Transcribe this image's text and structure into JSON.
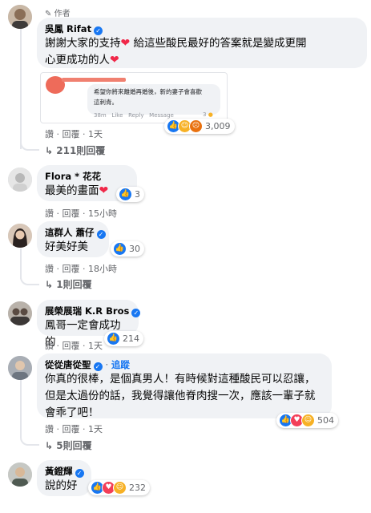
{
  "comments": [
    {
      "author": "吳鳳 Rifat",
      "author_badge": "作者",
      "text_line1": "謝謝大家的支持",
      "text_line1b": "給這些酸民最好的答案就是變成更開",
      "text_line2": "心更成功的人",
      "like": "讚",
      "reply": "回覆",
      "time": "1天",
      "reactions": "3,009",
      "replies": "211則回覆",
      "quote": {
        "text_line1": "希望你將來離婚再婚後，新的妻子會喜歡",
        "text_line2": "這刺青。",
        "time": "38m",
        "like": "Like",
        "reply": "Reply",
        "message": "Message",
        "count": "3"
      }
    },
    {
      "author": "Flora * 花花",
      "text": "最美的畫面",
      "like": "讚",
      "reply": "回覆",
      "time": "15小時",
      "reactions": "3"
    },
    {
      "author": "這群人 蕭仔",
      "text": "好美好美",
      "like": "讚",
      "reply": "回覆",
      "time": "18小時",
      "reactions": "30",
      "replies": "1則回覆"
    },
    {
      "author": "展榮展瑞 K.R Bros",
      "text": "鳳哥一定會成功的",
      "like": "讚",
      "reply": "回覆",
      "time": "1天",
      "reactions": "214"
    },
    {
      "author": "從從唐從聖",
      "follow": "追蹤",
      "text_line1": "你真的很棒，是個真男人！有時候對這種酸民可以忍讓，",
      "text_line2": "但是太過份的話，我覺得讓他脊肉搜一次，應該一輩子就",
      "text_line3": "會乖了吧！",
      "like": "讚",
      "reply": "回覆",
      "time": "1天",
      "reactions": "504",
      "replies": "5則回覆"
    },
    {
      "author": "黃鐙輝",
      "text": "說的好",
      "reactions": "232"
    }
  ],
  "icons": {
    "pen": "pen-icon",
    "verified": "verified-badge-icon",
    "heart": "heart-emoji-icon",
    "like": "like-reaction-icon",
    "love": "love-reaction-icon",
    "haha": "haha-reaction-icon",
    "angry": "angry-reaction-icon",
    "reply_arrow": "reply-arrow-icon"
  },
  "colors": {
    "accent": "#1877f2",
    "bubble": "#f0f2f5",
    "secondary_text": "#65676b",
    "heart": "#f02849"
  }
}
